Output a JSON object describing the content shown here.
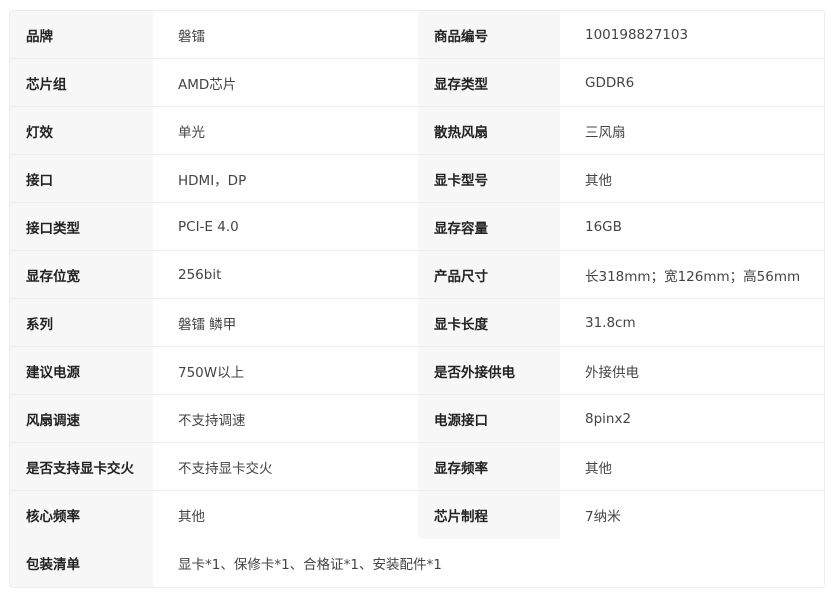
{
  "spec_rows": [
    {
      "label_left": "品牌",
      "value_left": "磐镭",
      "label_right": "商品编号",
      "value_right": "100198827103"
    },
    {
      "label_left": "芯片组",
      "value_left": "AMD芯片",
      "label_right": "显存类型",
      "value_right": "GDDR6"
    },
    {
      "label_left": "灯效",
      "value_left": "单光",
      "label_right": "散热风扇",
      "value_right": "三风扇"
    },
    {
      "label_left": "接口",
      "value_left": "HDMI，DP",
      "label_right": "显卡型号",
      "value_right": "其他"
    },
    {
      "label_left": "接口类型",
      "value_left": "PCI-E 4.0",
      "label_right": "显存容量",
      "value_right": "16GB"
    },
    {
      "label_left": "显存位宽",
      "value_left": "256bit",
      "label_right": "产品尺寸",
      "value_right": "长318mm；宽126mm；高56mm"
    },
    {
      "label_left": "系列",
      "value_left": "磐镭 鳞甲",
      "label_right": "显卡长度",
      "value_right": "31.8cm"
    },
    {
      "label_left": "建议电源",
      "value_left": "750W以上",
      "label_right": "是否外接供电",
      "value_right": "外接供电"
    },
    {
      "label_left": "风扇调速",
      "value_left": "不支持调速",
      "label_right": "电源接口",
      "value_right": "8pinx2"
    },
    {
      "label_left": "是否支持显卡交火",
      "value_left": "不支持显卡交火",
      "label_right": "显存频率",
      "value_right": "其他"
    },
    {
      "label_left": "核心频率",
      "value_left": "其他",
      "label_right": "芯片制程",
      "value_right": "7纳米"
    }
  ],
  "package": {
    "label": "包装清单",
    "value": "显卡*1、保修卡*1、合格证*1、安装配件*1"
  }
}
